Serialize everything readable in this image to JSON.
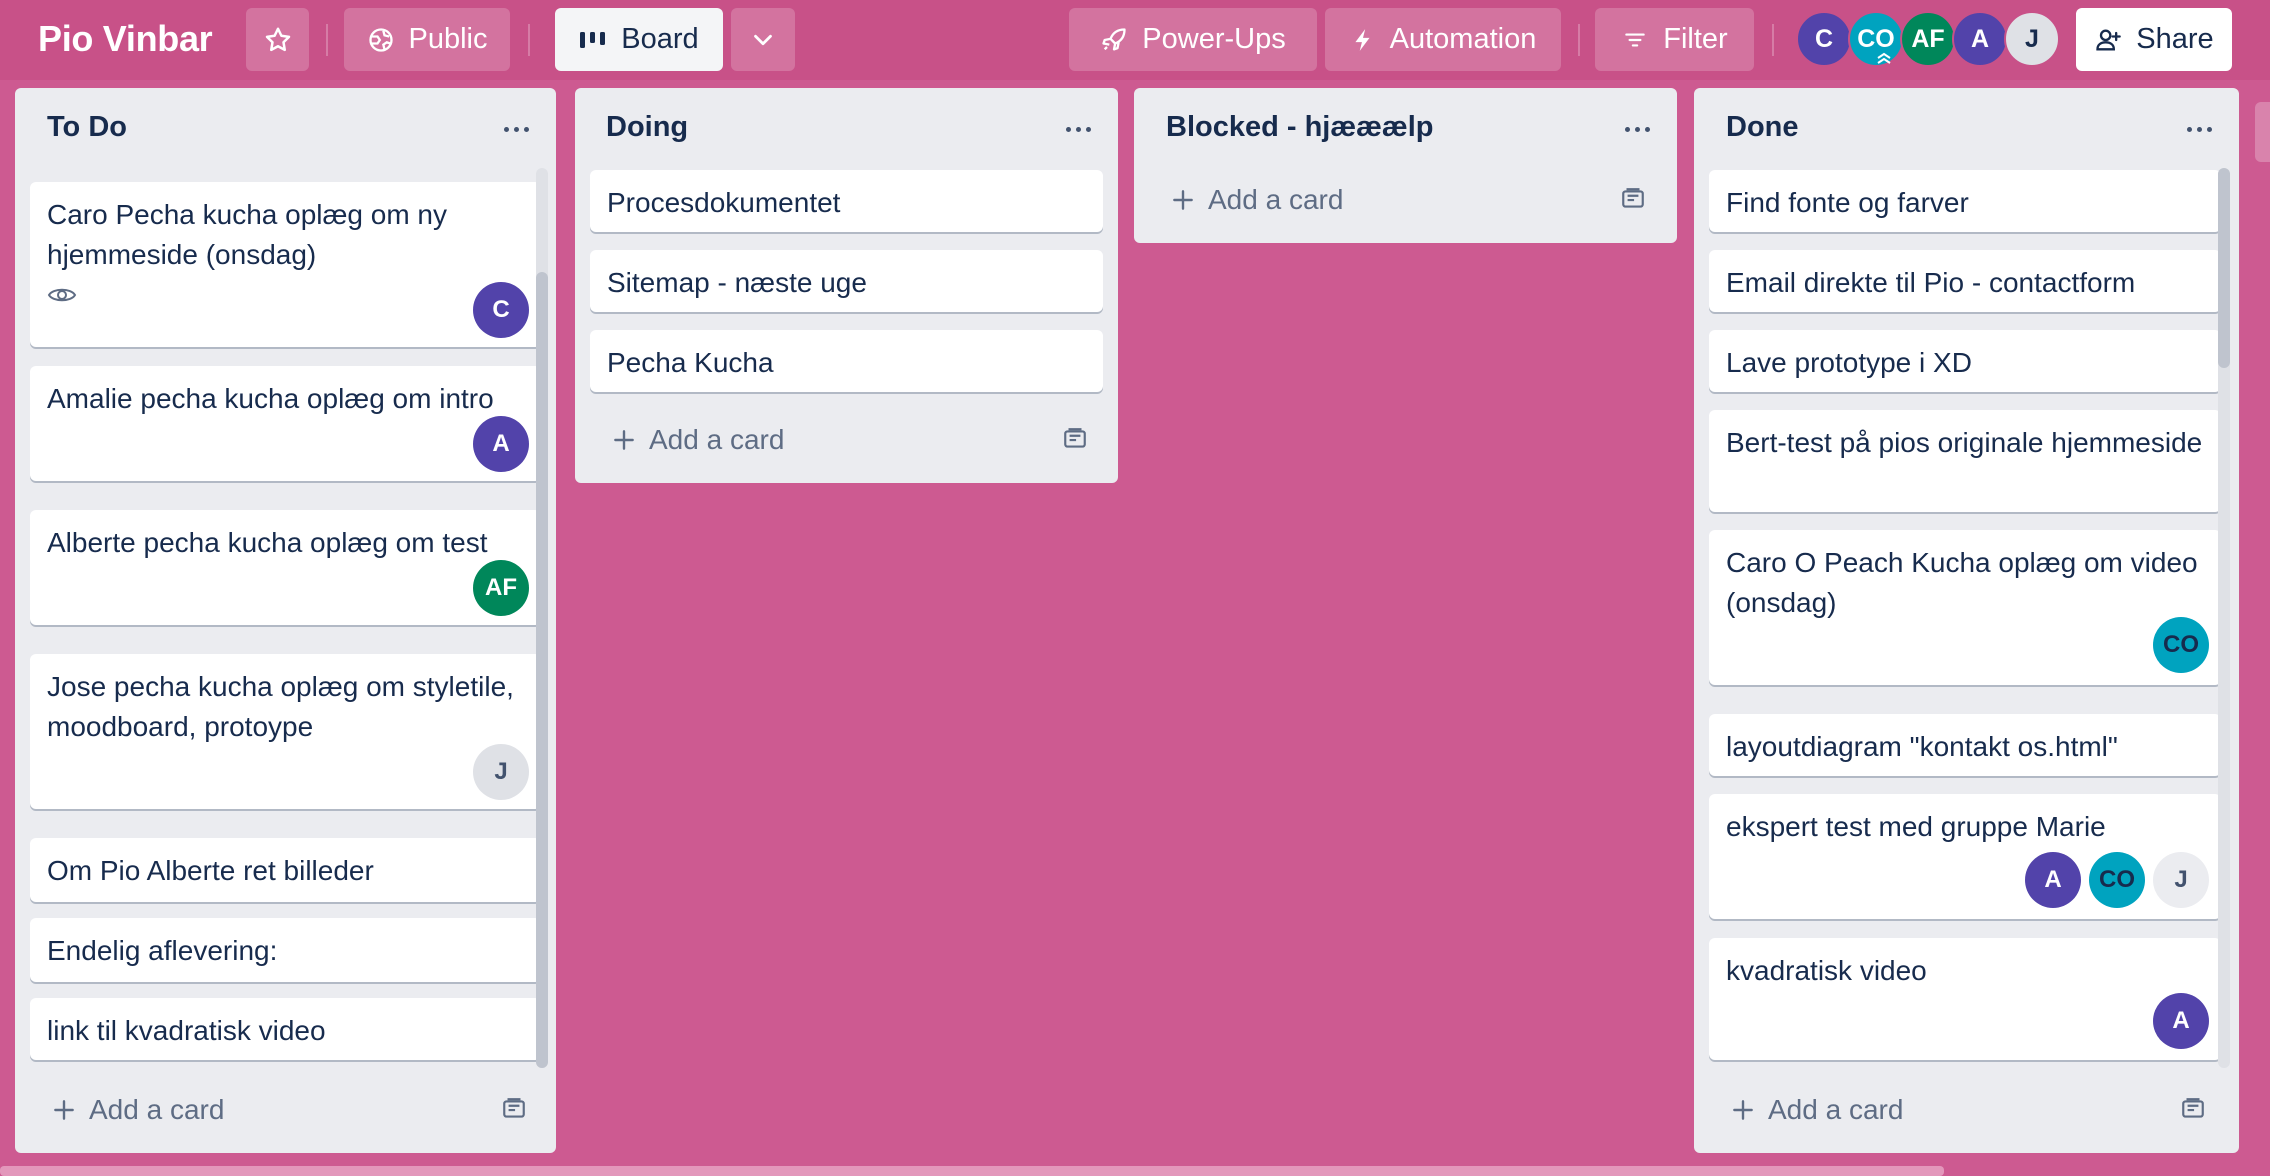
{
  "header": {
    "board_title": "Pio Vinbar",
    "visibility_label": "Public",
    "view_label": "Board",
    "powerups_label": "Power-Ups",
    "automation_label": "Automation",
    "filter_label": "Filter",
    "share_label": "Share",
    "members": [
      {
        "initials": "C",
        "color": "#5243aa"
      },
      {
        "initials": "CO",
        "color": "#00a3bf"
      },
      {
        "initials": "AF",
        "color": "#00875a"
      },
      {
        "initials": "A",
        "color": "#5243aa"
      },
      {
        "initials": "J",
        "color": "#dfe1e6"
      }
    ]
  },
  "lists": [
    {
      "title": "To Do",
      "add_label": "Add a card",
      "cards": [
        {
          "text": "Caro Pecha kucha oplæg om ny hjemmeside (onsdag)",
          "watching": true,
          "members": [
            {
              "initials": "C",
              "color": "#5243aa"
            }
          ]
        },
        {
          "text": "Amalie pecha kucha oplæg om intro",
          "members": [
            {
              "initials": "A",
              "color": "#5243aa"
            }
          ]
        },
        {
          "text": "Alberte pecha kucha oplæg om test",
          "members": [
            {
              "initials": "AF",
              "color": "#00875a"
            }
          ]
        },
        {
          "text": "Jose pecha kucha oplæg om styletile, moodboard, protoype",
          "members": [
            {
              "initials": "J",
              "color": "#dfe1e6"
            }
          ]
        },
        {
          "text": "Om Pio Alberte ret billeder"
        },
        {
          "text": "Endelig aflevering:"
        },
        {
          "text": "link til kvadratisk video"
        }
      ]
    },
    {
      "title": "Doing",
      "add_label": "Add a card",
      "cards": [
        {
          "text": "Procesdokumentet"
        },
        {
          "text": "Sitemap - næste uge"
        },
        {
          "text": "Pecha Kucha"
        }
      ]
    },
    {
      "title": "Blocked - hjææælp",
      "add_label": "Add a card",
      "cards": []
    },
    {
      "title": "Done",
      "add_label": "Add a card",
      "cards": [
        {
          "text": "Find fonte og farver"
        },
        {
          "text": "Email direkte til Pio - contactform"
        },
        {
          "text": "Lave prototype i XD"
        },
        {
          "text": "Bert-test på pios originale hjemmeside"
        },
        {
          "text": "Caro O Peach Kucha oplæg om video (onsdag)",
          "members": [
            {
              "initials": "CO",
              "color": "#00a3bf"
            }
          ]
        },
        {
          "text": "layoutdiagram \"kontakt os.html\""
        },
        {
          "text": "ekspert test med gruppe Marie",
          "members": [
            {
              "initials": "A",
              "color": "#5243aa"
            },
            {
              "initials": "CO",
              "color": "#00a3bf"
            },
            {
              "initials": "J",
              "color": "#dfe1e6"
            }
          ]
        },
        {
          "text": "kvadratisk video",
          "members": [
            {
              "initials": "A",
              "color": "#5243aa"
            }
          ]
        }
      ]
    }
  ]
}
